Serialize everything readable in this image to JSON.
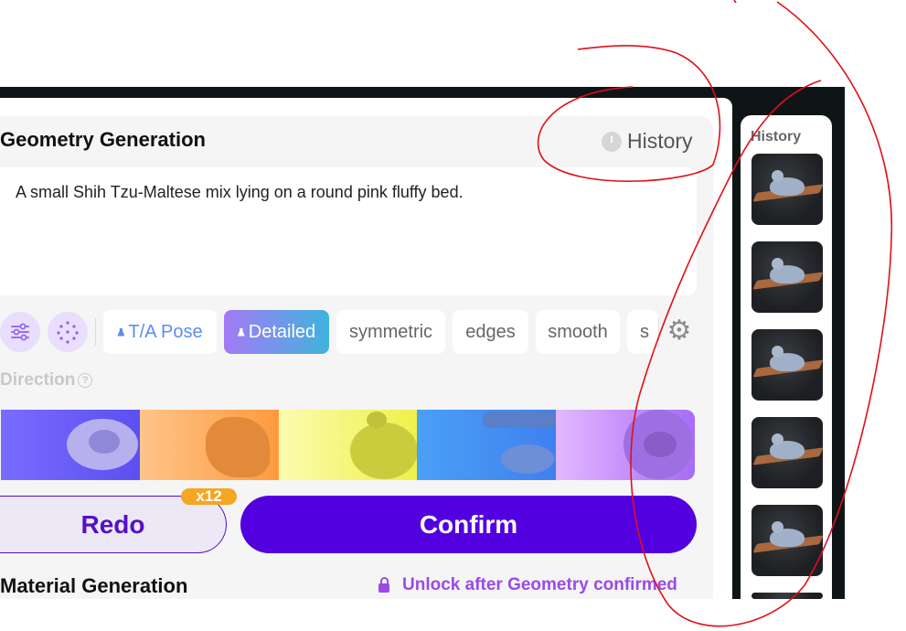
{
  "geometry": {
    "title": "Geometry Generation",
    "history_label": "History",
    "prompt": "A small Shih Tzu-Maltese mix lying on a round pink fluffy bed.",
    "chips": [
      "T/A Pose",
      "Detailed",
      "symmetric",
      "edges",
      "smooth",
      "s"
    ],
    "direction_label": "Direction",
    "direction_help": "?",
    "redo_label": "Redo",
    "redo_badge": "x12",
    "confirm_label": "Confirm"
  },
  "material": {
    "title": "Material Generation",
    "locked_text": "Unlock after Geometry confirmed"
  },
  "side_history": {
    "title": "History",
    "thumbnail_count": 5
  },
  "colors": {
    "primary": "#5300e0",
    "accent_purple": "#9b4ae8",
    "badge": "#f5a623",
    "annotation": "#e0101a"
  }
}
